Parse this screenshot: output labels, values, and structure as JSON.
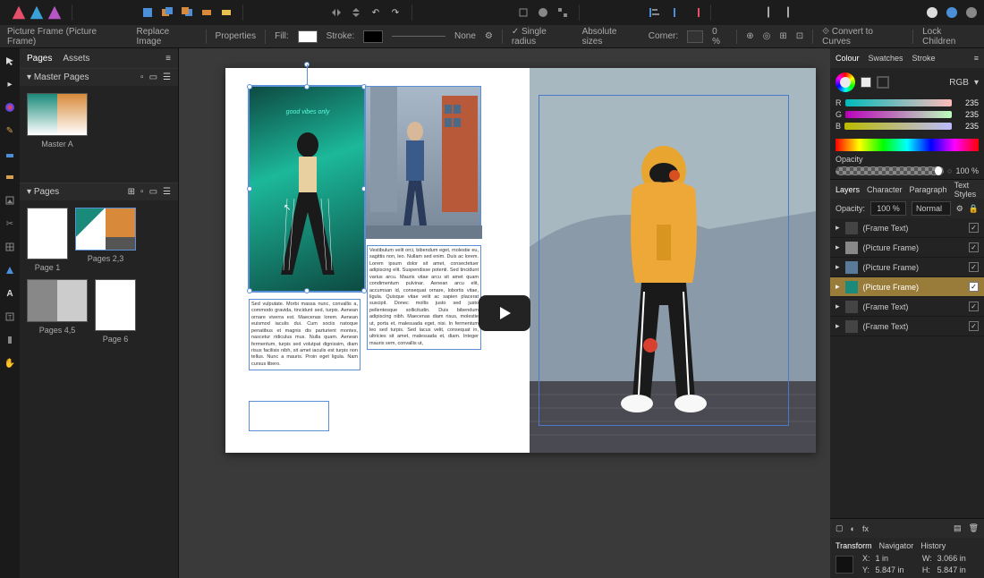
{
  "top": {
    "icons": [
      "affinity",
      "publisher",
      "designer",
      "photo",
      "gap",
      "sel",
      "align1",
      "align2",
      "align3",
      "gap",
      "flip-h",
      "flip-v",
      "rot-l",
      "rot-r",
      "gap",
      "crop",
      "mask",
      "group",
      "gap",
      "dist1",
      "dist2",
      "dist3",
      "gap",
      "insert1",
      "insert2",
      "gap",
      "circ1",
      "circ2",
      "circ3"
    ]
  },
  "context": {
    "title": "Picture Frame  (Picture Frame)",
    "replace": "Replace Image",
    "properties": "Properties",
    "fill": "Fill:",
    "stroke": "Stroke:",
    "strokeNone": "None",
    "singleRadius": "Single radius",
    "absSizes": "Absolute sizes",
    "corner": "Corner:",
    "cornerVal": "0 %",
    "convert": "Convert to Curves",
    "lock": "Lock Children"
  },
  "leftPanel": {
    "tab1": "Pages",
    "tab2": "Assets",
    "master": "Master Pages",
    "masterA": "Master A",
    "pages": "Pages",
    "p1": "Page 1",
    "p23": "Pages 2,3",
    "p45": "Pages 4,5",
    "p6": "Page 6"
  },
  "doc": {
    "text1": "Sed vulputate. Morbi massa nunc, convallis a, commodo gravida, tincidunt sed, turpis. Aenean ornare viverra est. Maecenas lorem. Aenean euismod iaculis dui. Cum sociis natoque penatibus et magnis dis parturient montes, nascetur ridiculus mus. Nulla quam. Aenean fermentum, turpis sed volutpat dignissim, diam risus facilisis nibh, sit amet iaculis est turpis non tellus. Nunc a mauris. Proin eget ligula. Nam cursus libero.",
    "text2": "Vestibulum velit orci, bibendum eget, molestie eu, sagittis non, leo. Nullam sed enim. Duis ac lorem. Lorem ipsum dolor sit amet, consectetuer adipiscing elit. Suspendisse potenti. Sed tincidunt varius arcu. Mauris vitae arcu sit amet quam condimentum pulvinar. Aenean arcu elit, accumsan id, consequat ornare, lobortis vitae, ligula. Quisque vitae velit ac sapien placerat suscipit. Donec mollis justo sed justo pellentesque sollicitudin. Duis bibendum adipiscing nibh. Maecenas diam risus, molestie ut, porta et, malesuada eget, nisi. In fermentum leo sed turpis. Sed lacus velit, consequat in, ultricies sit amet, malesuada et, diam. Integer mauris sem, convallis ut,"
  },
  "color": {
    "tab1": "Colour",
    "tab2": "Swatches",
    "tab3": "Stroke",
    "mode": "RGB",
    "r": "R",
    "g": "G",
    "b": "B",
    "rv": "235",
    "gv": "235",
    "bv": "235",
    "opacityLabel": "Opacity",
    "opacityVal": "100 %"
  },
  "layers": {
    "tab1": "Layers",
    "tab2": "Character",
    "tab3": "Paragraph",
    "tab4": "Text Styles",
    "opacL": "Opacity:",
    "opacV": "100 %",
    "blend": "Normal",
    "items": [
      {
        "name": "(Frame Text)",
        "sel": false
      },
      {
        "name": "(Picture Frame)",
        "sel": false
      },
      {
        "name": "(Picture Frame)",
        "sel": false
      },
      {
        "name": "(Picture Frame)",
        "sel": true
      },
      {
        "name": "(Frame Text)",
        "sel": false
      },
      {
        "name": "(Frame Text)",
        "sel": false
      }
    ]
  },
  "transform": {
    "tab1": "Transform",
    "tab2": "Navigator",
    "tab3": "History",
    "x": "X:",
    "xv": "1 in",
    "y": "Y:",
    "yv": "5.847 in",
    "w": "W:",
    "wv": "3.066 in",
    "h": "H:",
    "hv": "5.847 in"
  }
}
